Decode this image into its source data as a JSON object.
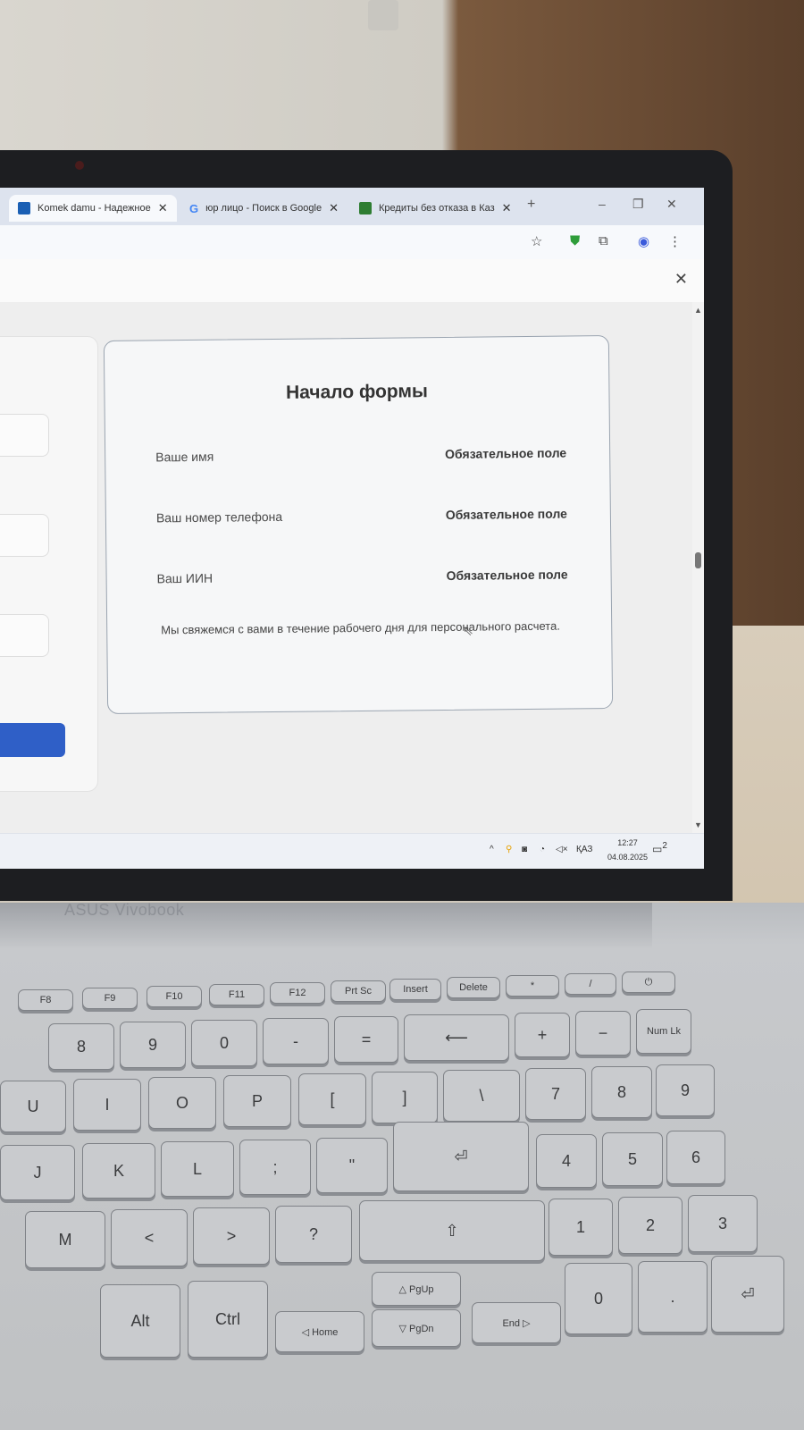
{
  "browser": {
    "tabs": [
      {
        "title": "Komek damu - Надежное",
        "favicon_color": "#1a5fb4",
        "active": true
      },
      {
        "title": "юр лицо - Поиск в Google",
        "favicon_color": "#4285f4",
        "active": false
      },
      {
        "title": "Кредиты без отказа в Каз",
        "favicon_color": "#2e7d32",
        "active": false
      }
    ],
    "new_tab_icon": "plus-icon",
    "window_controls": [
      "minimize-icon",
      "maximize-icon",
      "close-icon"
    ],
    "toolbar_icons": [
      "star-icon",
      "shield-extension-icon",
      "puzzle-extension-icon",
      "profile-icon",
      "menu-dots-icon"
    ]
  },
  "infobar": {
    "close_icon": "close-icon"
  },
  "form": {
    "title": "Начало формы",
    "fields": [
      {
        "label": "Ваше имя",
        "status": "Обязательное поле"
      },
      {
        "label": "Ваш номер телефона",
        "status": "Обязательное поле"
      },
      {
        "label": "Ваш ИИН",
        "status": "Обязательное поле"
      }
    ],
    "note": "Мы свяжемся с вами в течение рабочего дня для персонального расчета."
  },
  "taskbar": {
    "language": "ҚАЗ",
    "time": "12:27",
    "date": "04.08.2025",
    "notification_count": "2",
    "tray_icons": [
      "chevron-up-icon",
      "location-icon",
      "camera-icon",
      "wifi-icon",
      "speaker-muted-icon"
    ]
  },
  "laptop": {
    "brand": "ASUS Vivobook"
  },
  "keyboard": {
    "keys": [
      "F8",
      "F9",
      "F10",
      "F11",
      "F12",
      "Prt Sc",
      "Insert",
      "Delete",
      "*",
      "/",
      "⏻",
      "8",
      "9",
      "0",
      "-",
      "=",
      "⟵",
      "+",
      "−",
      "Num Lk",
      "U",
      "I",
      "O",
      "P",
      "[",
      "]",
      "\\",
      "7",
      "8",
      "9",
      "J",
      "K",
      "L",
      ";",
      "\"",
      "⏎",
      "4",
      "5",
      "6",
      "M",
      "<",
      ">",
      "?",
      "⇧",
      "1",
      "2",
      "3",
      "Alt",
      "Ctrl",
      "◁ Home",
      "△ PgUp",
      "▽ PgDn",
      "End ▷",
      "0",
      ".",
      "⏎"
    ],
    "sub_labels": [
      "Home",
      "PgUp",
      "End",
      "PgDn",
      "Insert",
      "Delete"
    ]
  }
}
